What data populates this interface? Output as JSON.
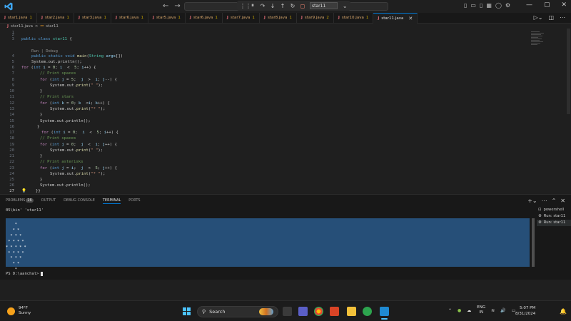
{
  "titlebar": {
    "search_text": "star11",
    "nav_back": "←",
    "nav_forward": "→"
  },
  "tabs": [
    {
      "label": "star1.java",
      "badge": "1"
    },
    {
      "label": "star2.java",
      "badge": "1"
    },
    {
      "label": "star3.java",
      "badge": "1"
    },
    {
      "label": "star6.java",
      "badge": "1"
    },
    {
      "label": "star5.java",
      "badge": "1"
    },
    {
      "label": "star6.java",
      "badge": "1"
    },
    {
      "label": "star7.java",
      "badge": "1"
    },
    {
      "label": "star8.java",
      "badge": "1"
    },
    {
      "label": "star9.java",
      "badge": "2"
    },
    {
      "label": "star10.java",
      "badge": "1"
    },
    {
      "label": "star11.java",
      "badge": ""
    }
  ],
  "breadcrumb": {
    "file": "star11.java",
    "sep": ">",
    "symbol": "star11"
  },
  "editor": {
    "line_numbers": [
      "1",
      "2",
      "3",
      "4",
      "5",
      "6",
      "7",
      "8",
      "9",
      "10",
      "11",
      "12",
      "13",
      "14",
      "15",
      "16",
      "17",
      "18",
      "19",
      "20",
      "21",
      "22",
      "23",
      "24",
      "25",
      "26",
      "27"
    ],
    "codelens": "Run | Debug",
    "class_decl": [
      "public",
      "class",
      "star11",
      "{"
    ],
    "main_decl": [
      "public",
      "static",
      "void",
      "main",
      "(",
      "String",
      " args",
      "[])"
    ],
    "l1": "System.out.println();",
    "l2": [
      "for",
      " (",
      "int",
      " i",
      " = ",
      "0",
      "; ",
      "i",
      "  <  ",
      "5",
      "; ",
      "i",
      "++) {"
    ],
    "c_spaces": "// Print spaces",
    "l4": [
      "for",
      " (",
      "int",
      " j",
      " = ",
      "5",
      ";  ",
      "j",
      "  >  ",
      "i",
      "; ",
      "j",
      "--) {"
    ],
    "print_space": [
      "System.out.",
      "print",
      "(",
      "\" \"",
      ");"
    ],
    "close": "}",
    "c_stars": "// Print stars",
    "l8": [
      "for",
      " (",
      "int",
      " k",
      " = ",
      "0",
      "; ",
      "k",
      "  <",
      "i",
      "; ",
      "k",
      "++) {"
    ],
    "print_star": [
      "System.out.",
      "print",
      "(",
      "\"* \"",
      ");"
    ],
    "println": "System.out.println();",
    "l14": [
      "for",
      " (",
      "int",
      " i",
      " = ",
      "0",
      ";  ",
      "i",
      "  <  ",
      "5",
      "; ",
      "i",
      "++) {"
    ],
    "l16": [
      "for",
      " (",
      "int",
      " j",
      " = ",
      "0",
      ";  ",
      "j",
      "  <  ",
      "i",
      "; ",
      "j",
      "++) {"
    ],
    "c_asterisks": "// Print asterisks",
    "l20": [
      "for",
      " (",
      "int",
      " j",
      " = ",
      "i",
      ";  ",
      "j",
      "  <  ",
      "5",
      "; ",
      "j",
      "++) {"
    ],
    "last_close": "}}"
  },
  "panel": {
    "tabs": [
      "PROBLEMS",
      "OUTPUT",
      "DEBUG CONSOLE",
      "TERMINAL",
      "PORTS"
    ],
    "problems_count": "16",
    "prev_line": "05\\bin' 'star11'",
    "star_output": "    *\n   * *\n  * * *\n * * * *\n* * * * *\n * * * *\n  * * *\n   * *\n    *",
    "prompt": "PS D:\\aanchal>",
    "terminals": [
      "powershell",
      "Run: star11",
      "Run: star11"
    ]
  },
  "taskbar": {
    "temp": "94°F",
    "condition": "Sunny",
    "search_label": "Search",
    "lang_line1": "ENG",
    "lang_line2": "IN",
    "time": "5:07 PM",
    "date": "8/31/2024"
  },
  "colors": {
    "accent": "#0078d4",
    "selection": "#264f78",
    "tab_text": "#d7a66b"
  }
}
